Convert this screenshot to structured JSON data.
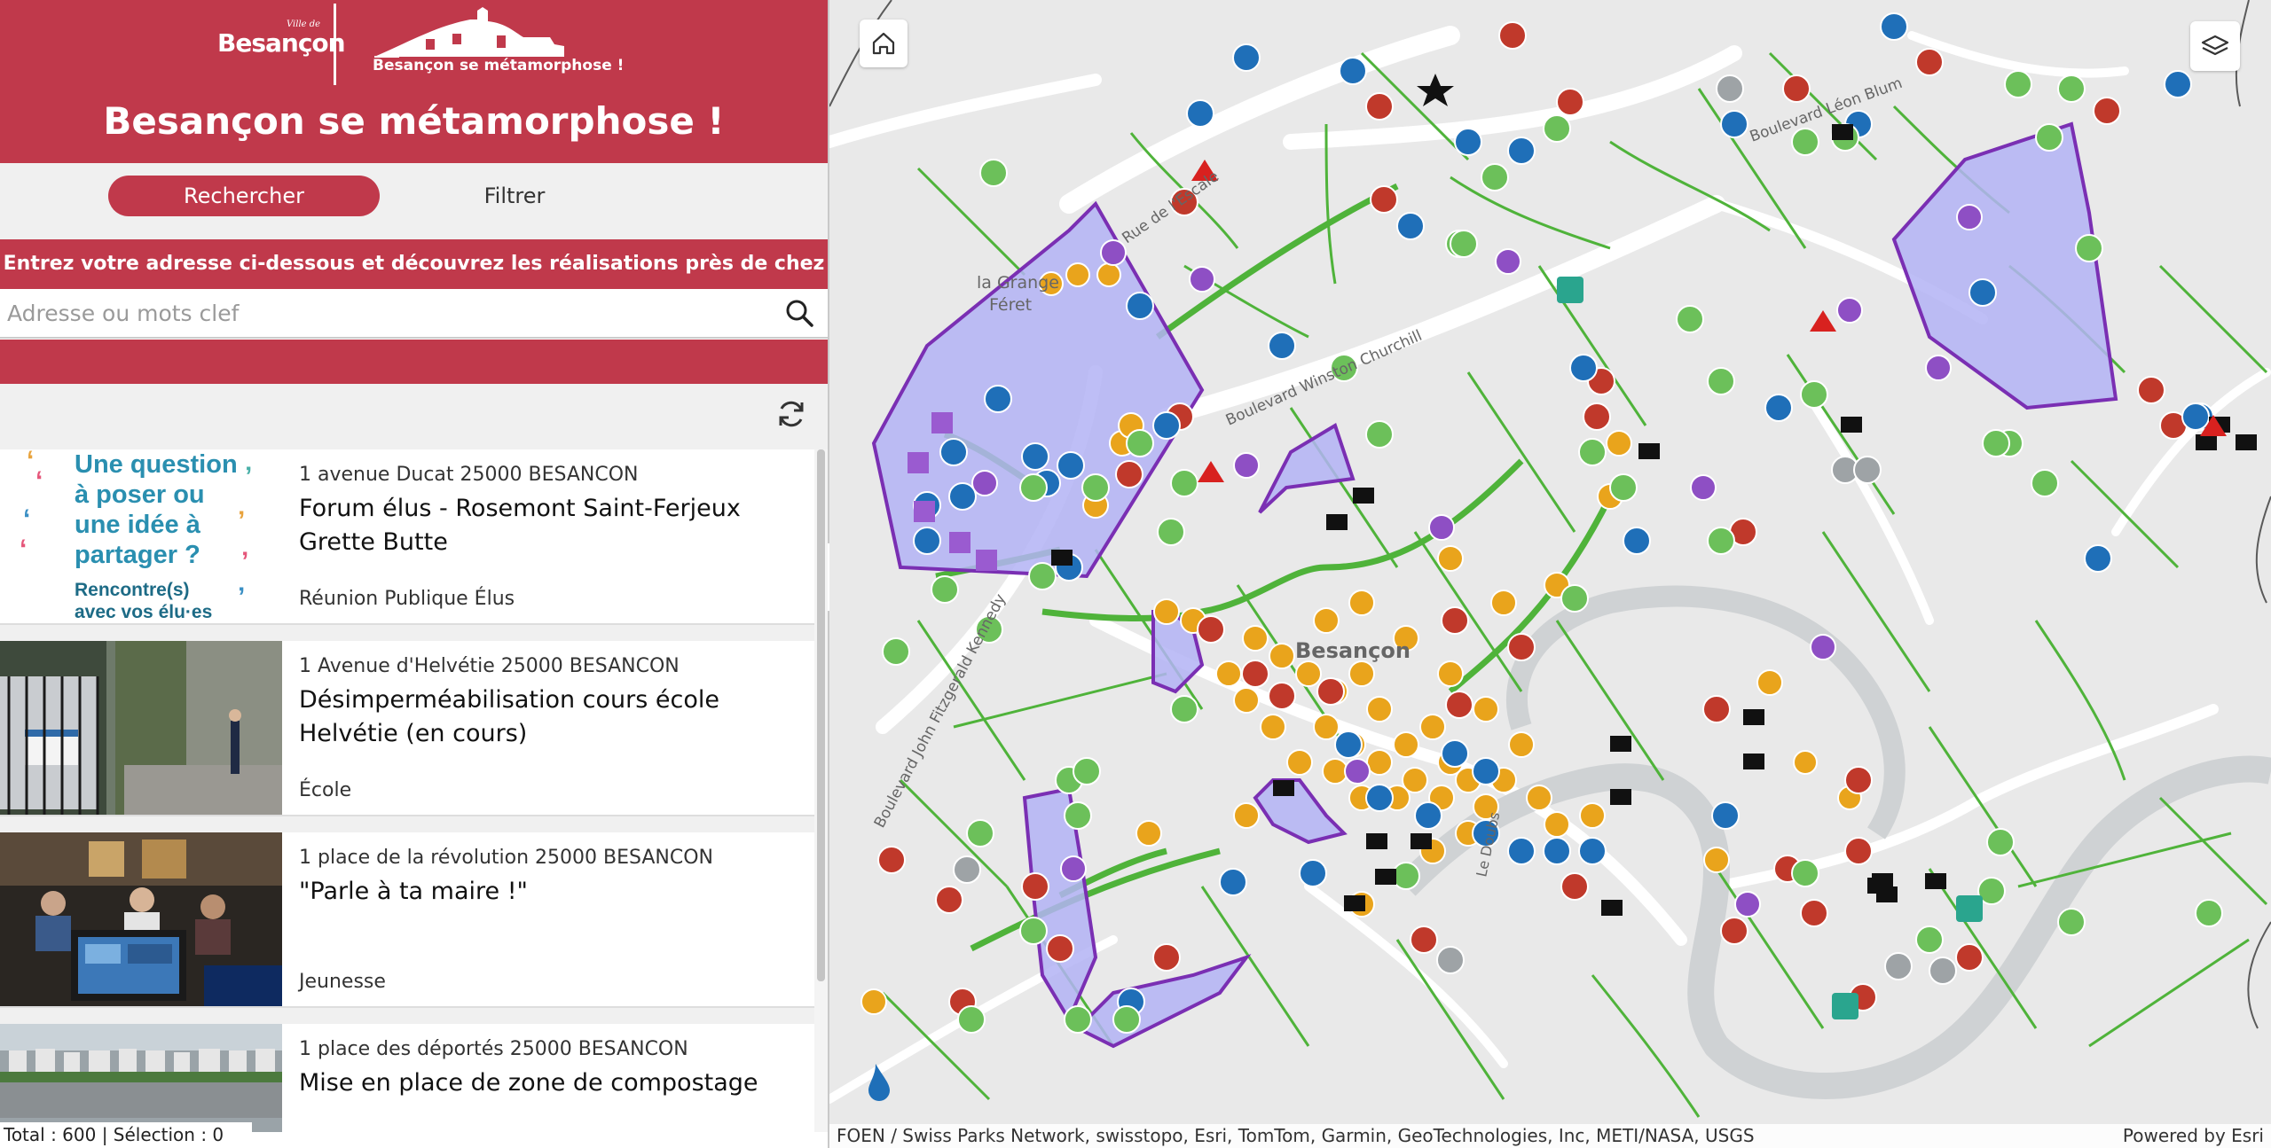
{
  "header": {
    "logo_ville_small": "Ville de",
    "logo_ville_name": "Besançon",
    "logo_meta_text": "Besançon se métamorphose !",
    "title": "Besançon se métamorphose !"
  },
  "tabs": {
    "search": "Rechercher",
    "filter": "Filtrer"
  },
  "banner": "Entrez votre adresse ci-dessous et découvrez les réalisations près de chez vous !",
  "search": {
    "placeholder": "Adresse ou mots clef",
    "value": ""
  },
  "thumb1": {
    "lines": [
      "Une question",
      "à poser ou",
      "une idée à",
      "partager ?",
      "Rencontre(s)",
      "avec vos élu·es"
    ]
  },
  "results": [
    {
      "address": "1 avenue Ducat  25000  BESANCON",
      "title": "Forum élus - Rosemont Saint-Ferjeux Grette Butte",
      "category": "Réunion Publique Élus"
    },
    {
      "address": "1 Avenue d'Helvétie  25000  BESANCON",
      "title": "Désimperméabilisation cours école Helvétie (en cours)",
      "category": "École"
    },
    {
      "address": "1 place de la révolution  25000  BESANCON",
      "title": "\"Parle à ta maire !\"",
      "category": "Jeunesse"
    },
    {
      "address": "1 place des déportés  25000  BESANCON",
      "title": "Mise en place de zone de compostage",
      "category": ""
    }
  ],
  "footer": "Total : 600 | Sélection : 0",
  "map": {
    "labels": {
      "grange": "la Grange",
      "feret": "Féret",
      "besancon": "Besançon",
      "escale": "Rue de l'Escale",
      "churchill": "Boulevard Winston Churchill",
      "kennedy": "Boulevard John Fitzgerald Kennedy",
      "blum": "Boulevard Léon Blum",
      "doubs": "Le Doubs"
    },
    "attribution": "FOEN / Swiss Parks Network, swisstopo, Esri, TomTom, Garmin, GeoTechnologies, Inc, METI/NASA, USGS",
    "powered_by": "Powered by Esri"
  },
  "colors": {
    "brand": "#c0394b",
    "zone_fill": "#b3b3f5",
    "zone_stroke": "#7a2fb3",
    "green_line": "#4fb33a",
    "gold": "#e9a41c",
    "blue": "#1f6fb8",
    "red": "#c0392b",
    "green_icon": "#6cc05a"
  }
}
